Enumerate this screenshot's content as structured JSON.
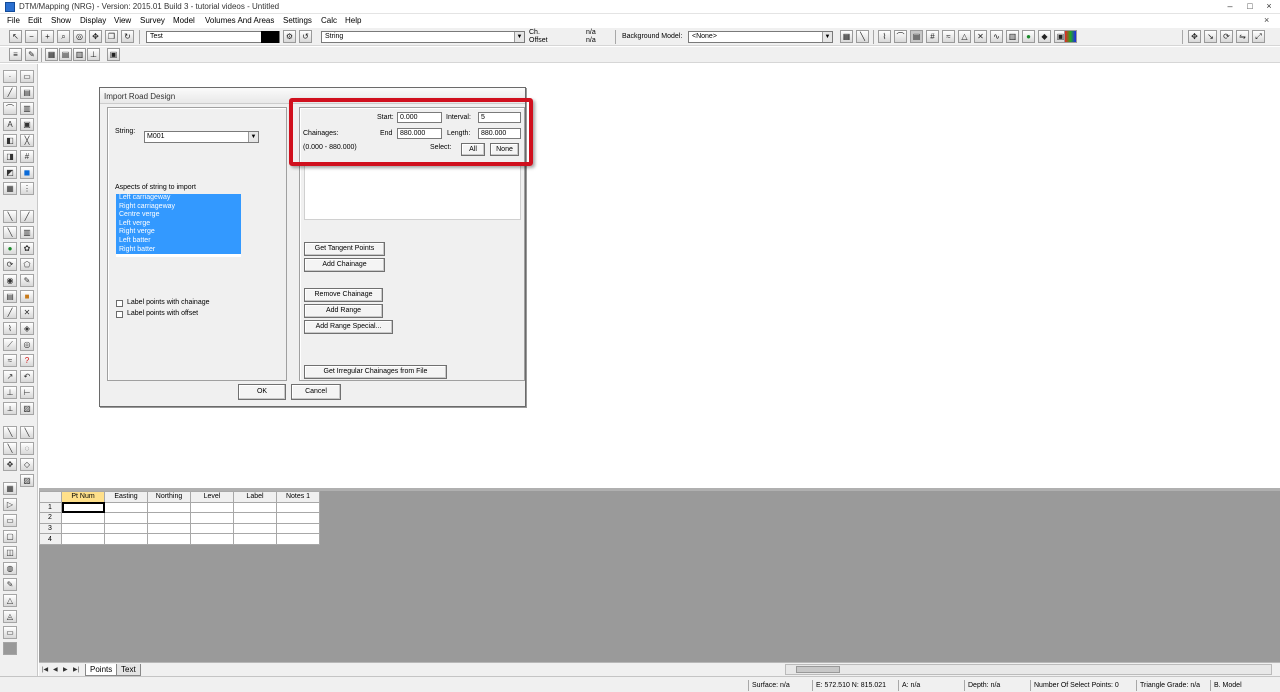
{
  "window": {
    "title": "DTM/Mapping (NRG) - Version: 2015.01 Build 3 - tutorial videos - Untitled",
    "controls": [
      "–",
      "□",
      "×"
    ]
  },
  "menu": [
    "File",
    "Edit",
    "Show",
    "Display",
    "View",
    "Survey",
    "Model",
    "Volumes And Areas",
    "Settings",
    "Calc",
    "Help"
  ],
  "toolbar": {
    "layer_value": "Test",
    "string_label": "String",
    "ch_label": "Ch.",
    "offset_label": "Offset",
    "ch_value": "n/a",
    "offset_value": "n/a",
    "background_model_label": "Background Model:",
    "background_model_value": "<None>"
  },
  "dialog": {
    "title": "Import Road Design",
    "string_label": "String:",
    "string_value": "M001",
    "aspects_label": "Aspects of string to import",
    "aspects": [
      "Left carriageway",
      "Right carriageway",
      "Centre verge",
      "Left verge",
      "Right verge",
      "Left batter",
      "Right batter"
    ],
    "label_chainage": "Label points with chainage",
    "label_offset": "Label points with offset",
    "start_label": "Start:",
    "start_value": "0.000",
    "interval_label": "Interval:",
    "interval_value": "5",
    "chainages_label": "Chainages:",
    "end_label": "End",
    "end_value": "880.000",
    "length_label": "Length:",
    "length_value": "880.000",
    "range_text": "(0.000 - 880.000)",
    "select_label": "Select:",
    "all_button": "All",
    "none_button": "None",
    "get_tangent_points": "Get Tangent Points",
    "add_chainage": "Add Chainage",
    "remove_chainage": "Remove Chainage",
    "add_range": "Add Range",
    "add_range_special": "Add Range Special...",
    "get_irregular": "Get Irregular Chainages from File",
    "ok": "OK",
    "cancel": "Cancel"
  },
  "grid": {
    "columns": [
      "Pt Num",
      "Easting",
      "Northing",
      "Level",
      "Label",
      "Notes 1"
    ],
    "rows": [
      "1",
      "2",
      "3",
      "4"
    ]
  },
  "sheet_tabs": [
    "Points",
    "Text"
  ],
  "status": {
    "surface": "Surface: n/a",
    "coords": "E: 572.510  N: 815.021",
    "angle": "A: n/a",
    "depth": "Depth: n/a",
    "select_points": "Number Of Select Points: 0",
    "triangle_grade": "Triangle Grade: n/a",
    "model": "B. Model"
  }
}
